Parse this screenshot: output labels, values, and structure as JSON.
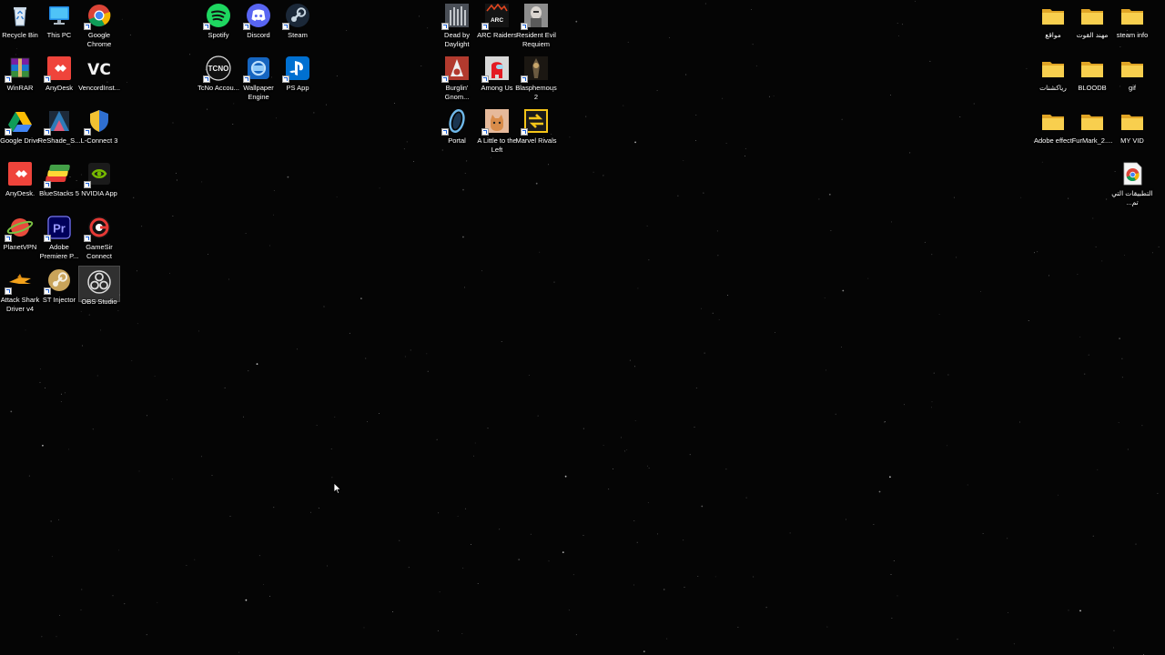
{
  "desktop": {
    "background_color": "#050505",
    "icons": [
      {
        "id": "recycle-bin",
        "label": "Recycle Bin",
        "icon": "recycle-bin-icon",
        "shortcut": false
      },
      {
        "id": "this-pc",
        "label": "This PC",
        "icon": "monitor-icon",
        "shortcut": false
      },
      {
        "id": "google-chrome",
        "label": "Google Chrome",
        "icon": "chrome-icon",
        "shortcut": true
      },
      {
        "id": "winrar",
        "label": "WinRAR",
        "icon": "winrar-icon",
        "shortcut": true
      },
      {
        "id": "anydesk",
        "label": "AnyDesk",
        "icon": "anydesk-icon",
        "shortcut": true
      },
      {
        "id": "vencord",
        "label": "VencordInst...",
        "icon": "vencord-icon",
        "shortcut": false
      },
      {
        "id": "google-drive",
        "label": "Google Drive",
        "icon": "google-drive-icon",
        "shortcut": true
      },
      {
        "id": "reshade",
        "label": "ReShade_S...",
        "icon": "reshade-icon",
        "shortcut": true
      },
      {
        "id": "l-connect",
        "label": "L-Connect 3",
        "icon": "shield-icon",
        "shortcut": true
      },
      {
        "id": "anydesk-2",
        "label": "AnyDesk.",
        "icon": "anydesk-icon",
        "shortcut": false
      },
      {
        "id": "bluestacks",
        "label": "BlueStacks 5",
        "icon": "bluestacks-icon",
        "shortcut": true
      },
      {
        "id": "nvidia-app",
        "label": "NVIDIA App",
        "icon": "nvidia-icon",
        "shortcut": true
      },
      {
        "id": "planetvpn",
        "label": "PlanetVPN",
        "icon": "planet-icon",
        "shortcut": true
      },
      {
        "id": "premiere",
        "label": "Adobe Premiere P...",
        "icon": "premiere-icon",
        "shortcut": true
      },
      {
        "id": "gamesir",
        "label": "GameSir Connect",
        "icon": "gamesir-icon",
        "shortcut": true
      },
      {
        "id": "attack-shark",
        "label": "Attack Shark Driver v4",
        "icon": "shark-icon",
        "shortcut": true
      },
      {
        "id": "st-injector",
        "label": "ST Injector",
        "icon": "steam-gold-icon",
        "shortcut": true
      },
      {
        "id": "obs-studio",
        "label": "OBS Studio",
        "icon": "obs-icon",
        "shortcut": false,
        "selected": true
      },
      {
        "id": "spotify",
        "label": "Spotify",
        "icon": "spotify-icon",
        "shortcut": true
      },
      {
        "id": "discord",
        "label": "Discord",
        "icon": "discord-icon",
        "shortcut": true
      },
      {
        "id": "steam",
        "label": "Steam",
        "icon": "steam-icon",
        "shortcut": true
      },
      {
        "id": "tcno",
        "label": "TcNo Accou...",
        "icon": "tcno-icon",
        "shortcut": true
      },
      {
        "id": "wallpaper-engine",
        "label": "Wallpaper Engine",
        "icon": "wallpaper-engine-icon",
        "shortcut": true
      },
      {
        "id": "ps-app",
        "label": "PS App",
        "icon": "playstation-icon",
        "shortcut": true
      },
      {
        "id": "dead-by-daylight",
        "label": "Dead by Daylight",
        "icon": "dbd-icon",
        "shortcut": true
      },
      {
        "id": "arc-raiders",
        "label": "ARC Raiders",
        "icon": "arc-raiders-icon",
        "shortcut": true
      },
      {
        "id": "resident-evil",
        "label": "Resident Evil Requiem",
        "icon": "resident-evil-icon",
        "shortcut": true
      },
      {
        "id": "burglin-gnomes",
        "label": "Burglin' Gnom...",
        "icon": "gnome-icon",
        "shortcut": true
      },
      {
        "id": "among-us",
        "label": "Among Us",
        "icon": "among-us-icon",
        "shortcut": true
      },
      {
        "id": "blasphemous",
        "label": "Blasphemous 2",
        "icon": "blasphemous-icon",
        "shortcut": true
      },
      {
        "id": "portal",
        "label": "Portal",
        "icon": "portal-icon",
        "shortcut": true
      },
      {
        "id": "little-to-the-left",
        "label": "A Little to the Left",
        "icon": "cat-icon",
        "shortcut": true
      },
      {
        "id": "marvel-rivals",
        "label": "Marvel Rivals",
        "icon": "marvel-icon",
        "shortcut": true
      },
      {
        "id": "folder-sites",
        "label": "مواقع",
        "icon": "folder-icon",
        "shortcut": false,
        "rtl": true
      },
      {
        "id": "folder-power",
        "label": "مهند القوت",
        "icon": "folder-icon",
        "shortcut": false,
        "rtl": true
      },
      {
        "id": "folder-steam-info",
        "label": "steam info",
        "icon": "folder-icon",
        "shortcut": false
      },
      {
        "id": "folder-reactions",
        "label": "رياكشنات",
        "icon": "folder-icon",
        "shortcut": false,
        "rtl": true
      },
      {
        "id": "folder-bloodb",
        "label": "BLOODB",
        "icon": "folder-icon",
        "shortcut": false
      },
      {
        "id": "folder-gif",
        "label": "gif",
        "icon": "folder-icon",
        "shortcut": false
      },
      {
        "id": "folder-adobe-effect",
        "label": "Adobe effect",
        "icon": "folder-icon",
        "shortcut": false
      },
      {
        "id": "folder-furmark",
        "label": "FurMark_2....",
        "icon": "folder-icon",
        "shortcut": false
      },
      {
        "id": "folder-my-vid",
        "label": "MY VID",
        "icon": "folder-icon",
        "shortcut": false
      },
      {
        "id": "chrome-apps",
        "label": "التطبيقات التي تم...",
        "icon": "chrome-apps-icon",
        "shortcut": false,
        "rtl": true
      }
    ]
  }
}
